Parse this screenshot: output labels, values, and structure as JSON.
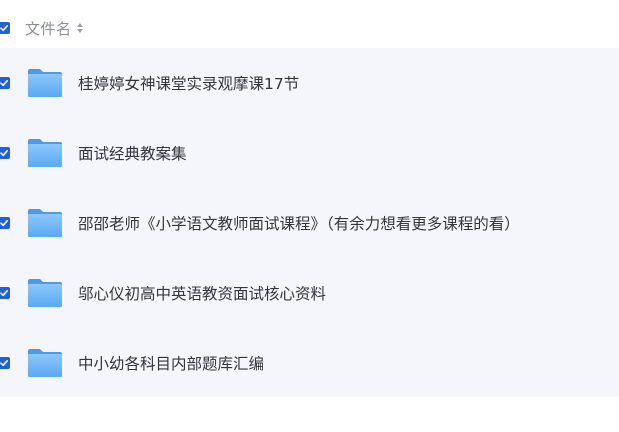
{
  "header": {
    "column_label": "文件名",
    "sort_icon": "sort-icon",
    "select_all_checked": true
  },
  "rows": [
    {
      "name": "桂婷婷女神课堂实录观摩课17节",
      "icon": "folder-icon",
      "checked": true
    },
    {
      "name": "面试经典教案集",
      "icon": "folder-icon",
      "checked": true
    },
    {
      "name": "邵邵老师《小学语文教师面试课程》（有余力想看更多课程的看）",
      "icon": "folder-icon",
      "checked": true
    },
    {
      "name": "邬心仪初高中英语教资面试核心资料",
      "icon": "folder-icon",
      "checked": true
    },
    {
      "name": "中小幼各科目内部题库汇编",
      "icon": "folder-icon",
      "checked": true
    }
  ],
  "colors": {
    "accent": "#1f5fe0",
    "row_background": "#f4f6fc",
    "folder": "#6fb4f7"
  }
}
